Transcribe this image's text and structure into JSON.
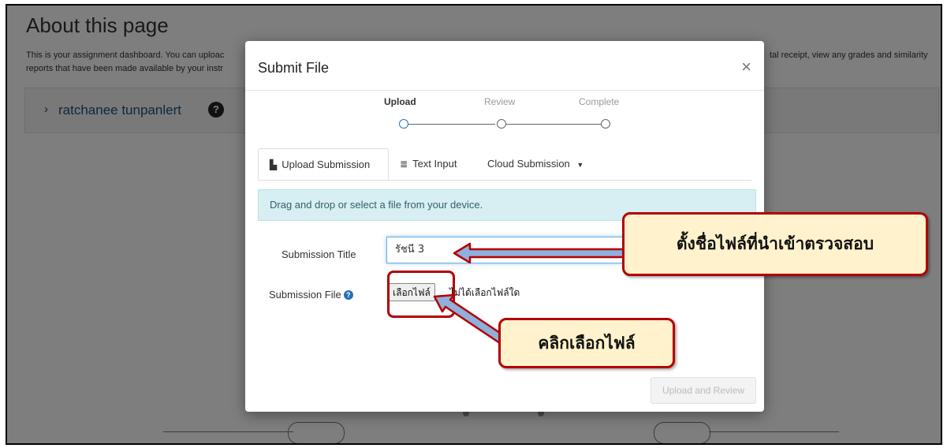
{
  "background_page": {
    "title": "About this page",
    "description_left": "This is your assignment dashboard. You can uploac",
    "description_left_line2": "reports that have been made available by your instr",
    "description_right": "tal receipt, view any grades and similarity",
    "user_name": "ratchanee tunpanlert"
  },
  "modal": {
    "title": "Submit File",
    "close_glyph": "×",
    "steps": [
      {
        "label": "Upload",
        "active": true
      },
      {
        "label": "Review",
        "active": false
      },
      {
        "label": "Complete",
        "active": false
      }
    ],
    "tabs": [
      {
        "label": "Upload Submission",
        "icon": "file-icon",
        "active": true
      },
      {
        "label": "Text Input",
        "icon": "text-lines-icon",
        "active": false
      },
      {
        "label": "Cloud Submission",
        "icon": "caret-down-icon",
        "active": false
      }
    ],
    "info_text": "Drag and drop or select a file from your device.",
    "submission_title_label": "Submission Title",
    "submission_title_value": "รัชนี 3",
    "submission_file_label": "Submission File",
    "choose_file_button": "เลือกไฟล์",
    "no_file_text": "ไม่ได้เลือกไฟล์ใด",
    "upload_review_button": "Upload and Review"
  },
  "annotations": {
    "callout_title": "ตั้งชื่อไฟล์ที่นำเข้าตรวจสอบ",
    "callout_file": "คลิกเลือกไฟล์"
  },
  "colors": {
    "callout_fill": "#fff2cc",
    "callout_border": "#b30000",
    "arrow_fill": "#8fb0dc",
    "info_box": "#d7eef2"
  }
}
